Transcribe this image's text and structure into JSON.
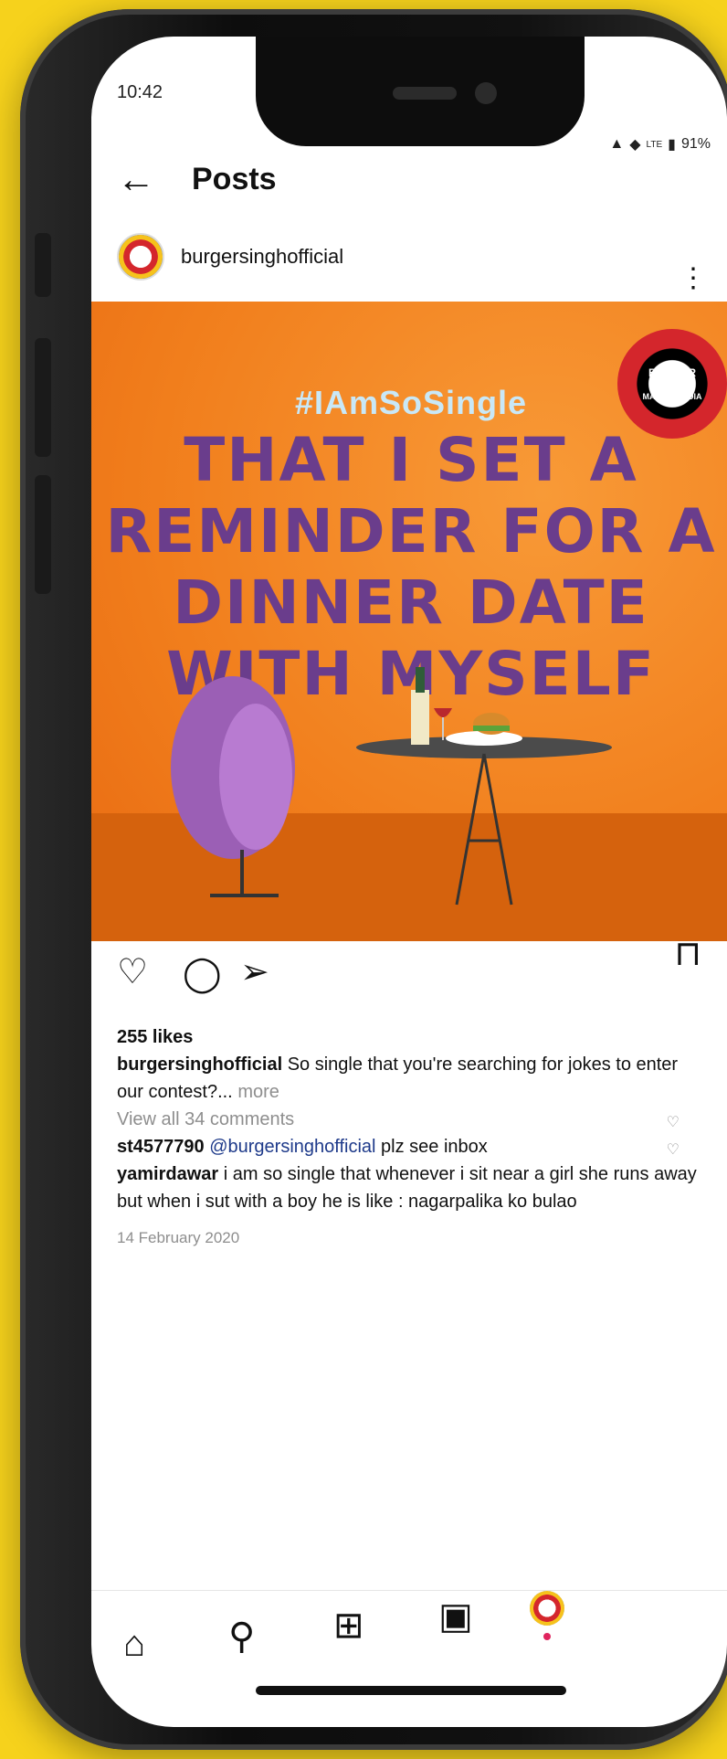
{
  "status_bar": {
    "time": "10:42",
    "network": "LTE",
    "battery": "91%"
  },
  "header": {
    "title": "Posts"
  },
  "post": {
    "author": "burgersinghofficial",
    "image": {
      "hashtag": "#IAmSoSingle",
      "headline_lines": [
        "THAT I SET A",
        "REMINDER FOR A",
        "DINNER DATE",
        "WITH MYSELF"
      ],
      "badge_top": "BURGER",
      "badge_right": "SINGH",
      "badge_bottom": "MADE IN INDIA"
    },
    "likes": "255 likes",
    "caption_text": "So single that you're searching for jokes to enter our contest?...",
    "caption_more": "more",
    "view_comments": "View all 34 comments",
    "comments": [
      {
        "user": "st4577790",
        "mention": "@burgersinghofficial",
        "text": "plz see inbox"
      },
      {
        "user": "yamirdawar",
        "text": "i am so single that whenever i sit near a girl she runs away but when i sut with a boy he is like : nagarpalika ko bulao"
      }
    ],
    "date": "14 February 2020"
  },
  "colors": {
    "background": "#f6d21c",
    "post_orange": "#f17e1c",
    "headline_purple": "#6a3d8c",
    "mention_blue": "#1e3a8a"
  },
  "icons": {
    "back": "arrow-left-icon",
    "more": "more-vertical-icon",
    "like": "heart-icon",
    "comment": "comment-icon",
    "share": "send-icon",
    "save": "bookmark-icon",
    "home": "home-icon",
    "search": "search-icon",
    "create": "plus-square-icon",
    "reels": "reels-icon"
  }
}
